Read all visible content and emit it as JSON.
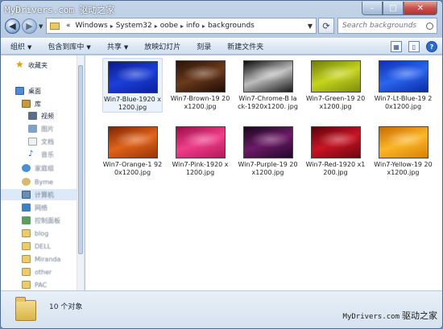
{
  "watermark_top": {
    "site": "MyDrivers.com",
    "brand": "驱动之家"
  },
  "watermark_bottom": {
    "site": "MyDrivers.com",
    "brand": "驱动之家"
  },
  "address": {
    "prefix": "«",
    "segments": [
      "Windows",
      "System32",
      "oobe",
      "info",
      "backgrounds"
    ]
  },
  "search": {
    "placeholder": "Search backgrounds"
  },
  "toolbar": {
    "organize": "组织",
    "include_in_library": "包含到库中",
    "share": "共享",
    "slideshow": "放映幻灯片",
    "burn": "刻录",
    "new_folder": "新建文件夹"
  },
  "nav": {
    "favorites": "收藏夹",
    "desktop": "桌面",
    "libraries": "库",
    "videos": "视频",
    "pictures": "图片",
    "documents": "文档",
    "music": "音乐",
    "homegroup": "家庭组",
    "user": "Byme",
    "computer": "计算机",
    "network": "网络",
    "control_panel": "控制面板",
    "folders": [
      "blog",
      "DELL",
      "Miranda",
      "other",
      "PAC"
    ]
  },
  "files": [
    {
      "name": "Win7-Blue-1920x1200.jpg",
      "label": "Win7-Blue-1920 x1200.jpg",
      "colors": [
        "#0a1a8c",
        "#1c3fd8",
        "#0b1f9e"
      ]
    },
    {
      "name": "Win7-Brown-1920x1200.jpg",
      "label": "Win7-Brown-19 20x1200.jpg",
      "colors": [
        "#2a1208",
        "#6b3a1c",
        "#1e0b05"
      ]
    },
    {
      "name": "Win7-Chrome-Black-1920x1200.jpg",
      "label": "Win7-Chrome-B lack-1920x1200. jpg",
      "colors": [
        "#0c0c0c",
        "#bdbdbd",
        "#1a1a1a"
      ]
    },
    {
      "name": "Win7-Green-1920x1200.jpg",
      "label": "Win7-Green-19 20x1200.jpg",
      "colors": [
        "#6e7e0a",
        "#c6d41c",
        "#7d8c0e"
      ]
    },
    {
      "name": "Win7-Lt-Blue-1920x1200.jpg",
      "label": "Win7-Lt-Blue-19 20x1200.jpg",
      "colors": [
        "#0c2fb4",
        "#2b66ef",
        "#0a2aa5"
      ]
    },
    {
      "name": "Win7-Orange-1920x1200.jpg",
      "label": "Win7-Orange-1 920x1200.jpg",
      "colors": [
        "#7e2404",
        "#e0641a",
        "#9a3306"
      ]
    },
    {
      "name": "Win7-Pink-1920x1200.jpg",
      "label": "Win7-Pink-1920 x1200.jpg",
      "colors": [
        "#9a0d4a",
        "#f03e8a",
        "#b3175a"
      ]
    },
    {
      "name": "Win7-Purple-1920x1200.jpg",
      "label": "Win7-Purple-19 20x1200.jpg",
      "colors": [
        "#1a0520",
        "#6c1a66",
        "#22072a"
      ]
    },
    {
      "name": "Win7-Red-1920x1200.jpg",
      "label": "Win7-Red-1920 x1200.jpg",
      "colors": [
        "#5b0308",
        "#c81424",
        "#6e0510"
      ]
    },
    {
      "name": "Win7-Yellow-1920x1200.jpg",
      "label": "Win7-Yellow-19 20x1200.jpg",
      "colors": [
        "#c86a04",
        "#fbb628",
        "#d98006"
      ]
    }
  ],
  "status": {
    "count_text": "10 个对象"
  }
}
